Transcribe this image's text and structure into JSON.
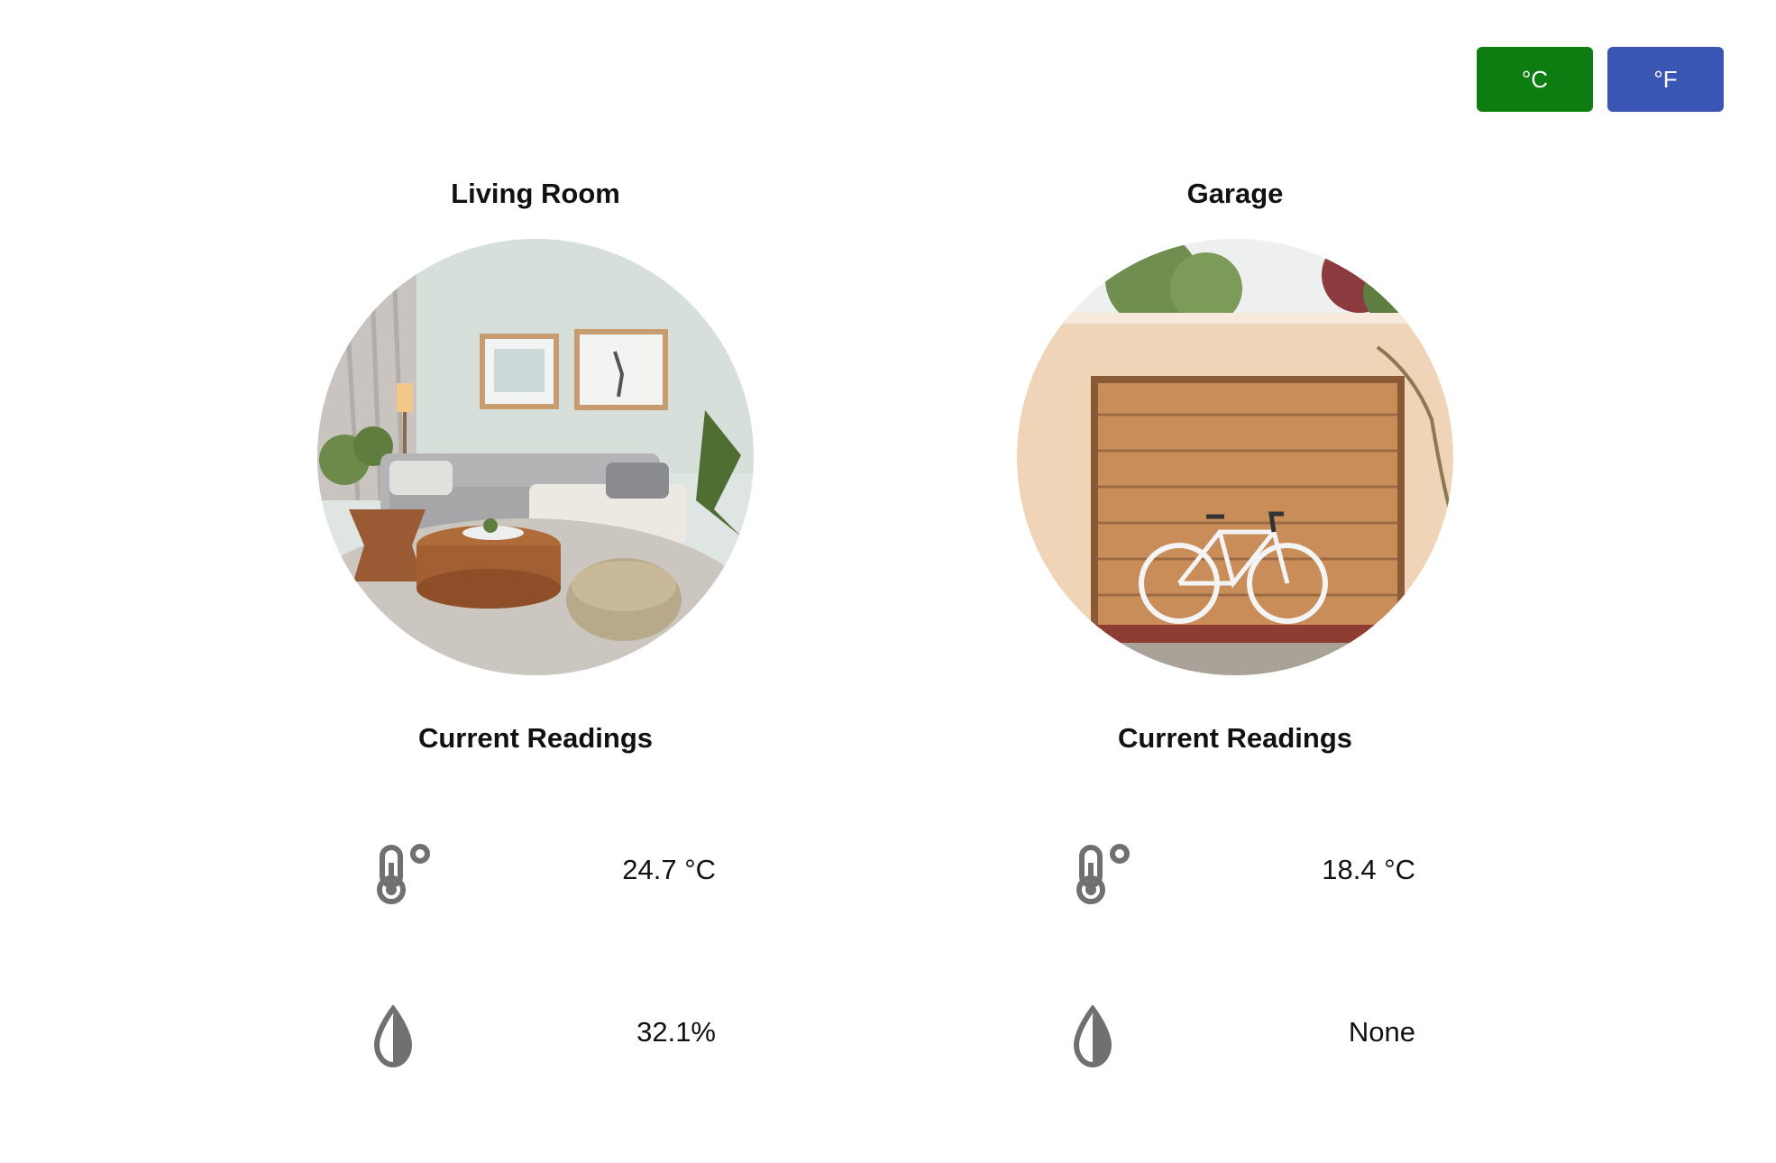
{
  "units": {
    "celsius_label": "°C",
    "fahrenheit_label": "°F",
    "celsius_color": "#0d7d12",
    "fahrenheit_color": "#3a56b4"
  },
  "rooms": [
    {
      "title": "Living Room",
      "readings_heading": "Current Readings",
      "temperature": "24.7 °C",
      "humidity": "32.1%",
      "temperature_icon": "thermometer-icon",
      "humidity_icon": "humidity-drop-icon"
    },
    {
      "title": "Garage",
      "readings_heading": "Current Readings",
      "temperature": "18.4 °C",
      "humidity": "None",
      "temperature_icon": "thermometer-icon",
      "humidity_icon": "humidity-drop-icon"
    }
  ],
  "colors": {
    "icon": "#707070"
  }
}
